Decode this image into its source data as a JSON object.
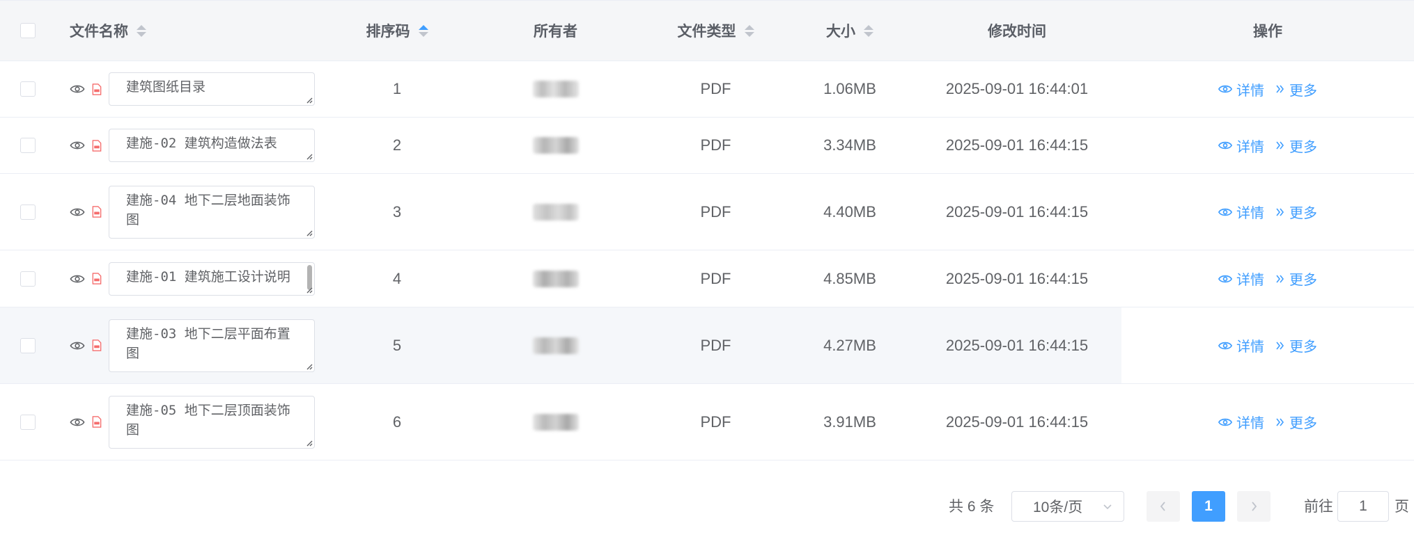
{
  "header": {
    "name": "文件名称",
    "sort": "排序码",
    "owner": "所有者",
    "type": "文件类型",
    "size": "大小",
    "time": "修改时间",
    "op": "操作"
  },
  "rows": [
    {
      "name": "建筑图纸目录",
      "sort": "1",
      "type": "PDF",
      "size": "1.06MB",
      "time": "2025-09-01 16:44:01"
    },
    {
      "name": "建施-02 建筑构造做法表",
      "sort": "2",
      "type": "PDF",
      "size": "3.34MB",
      "time": "2025-09-01 16:44:15"
    },
    {
      "name": "建施-04 地下二层地面装饰图",
      "sort": "3",
      "type": "PDF",
      "size": "4.40MB",
      "time": "2025-09-01 16:44:15"
    },
    {
      "name": "建施-01 建筑施工设计说明",
      "sort": "4",
      "type": "PDF",
      "size": "4.85MB",
      "time": "2025-09-01 16:44:15"
    },
    {
      "name": "建施-03 地下二层平面布置图",
      "sort": "5",
      "type": "PDF",
      "size": "4.27MB",
      "time": "2025-09-01 16:44:15"
    },
    {
      "name": "建施-05 地下二层顶面装饰图",
      "sort": "6",
      "type": "PDF",
      "size": "3.91MB",
      "time": "2025-09-01 16:44:15"
    }
  ],
  "actions": {
    "detail": "详情",
    "more": "更多"
  },
  "pagination": {
    "total": "共 6 条",
    "page_size": "10条/页",
    "current": "1",
    "goto_prefix": "前往",
    "goto_value": "1",
    "goto_suffix": "页"
  },
  "colors": {
    "accent": "#409eff",
    "pdf": "#f56c6c",
    "border": "#dcdfe6"
  },
  "icons": [
    "checkbox",
    "sort-caret-icon",
    "eye-icon",
    "pdf-file-icon",
    "detail-eye-icon",
    "more-chevrons-icon",
    "chevron-left-icon",
    "chevron-right-icon",
    "chevron-down-icon"
  ]
}
